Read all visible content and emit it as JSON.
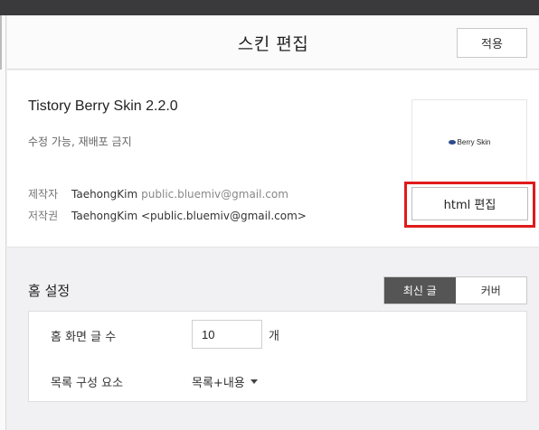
{
  "header": {
    "title": "스킨 편집",
    "apply_label": "적용"
  },
  "skin": {
    "name": "Tistory Berry Skin 2.2.0",
    "license": "수정 가능, 재배포 금지",
    "maker_key": "제작자",
    "maker_name": "TaehongKim",
    "maker_email": "public.bluemiv@gmail.com",
    "copyright_key": "저작권",
    "copyright_value": "TaehongKim <public.bluemiv@gmail.com>",
    "thumbnail_text": "Berry Skin",
    "html_edit_label": "html 편집"
  },
  "home_settings": {
    "title": "홈 설정",
    "tabs": [
      {
        "label": "최신 글",
        "active": true
      },
      {
        "label": "커버",
        "active": false
      }
    ],
    "post_count_label": "홈 화면 글 수",
    "post_count_value": "10",
    "post_count_unit": "개",
    "list_components_label": "목록 구성 요소",
    "list_components_value": "목록+내용"
  },
  "colors": {
    "topbar": "#3a3a3c",
    "active_tab": "#555555",
    "highlight": "#e01a1a"
  }
}
